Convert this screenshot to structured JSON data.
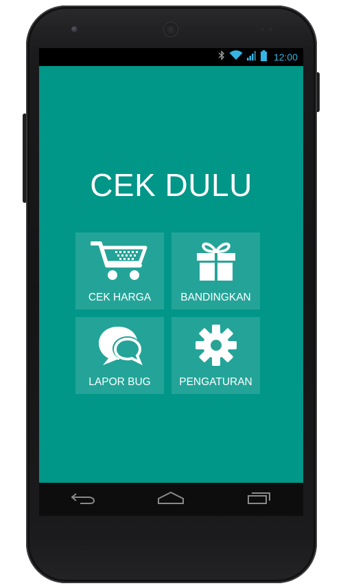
{
  "status_bar": {
    "time": "12:00",
    "icons": [
      "bluetooth-icon",
      "wifi-icon",
      "signal-icon",
      "battery-icon"
    ],
    "icon_color": "#33b5e5"
  },
  "app": {
    "title": "CEK DULU",
    "background_color": "#009688",
    "menu": [
      {
        "label": "CEK HARGA",
        "icon": "shopping-cart-icon"
      },
      {
        "label": "BANDINGKAN",
        "icon": "gift-icon"
      },
      {
        "label": "LAPOR BUG",
        "icon": "chat-bubbles-icon"
      },
      {
        "label": "PENGATURAN",
        "icon": "gear-icon"
      }
    ]
  },
  "nav_bar": {
    "buttons": [
      "back-icon",
      "home-icon",
      "recent-apps-icon"
    ]
  }
}
